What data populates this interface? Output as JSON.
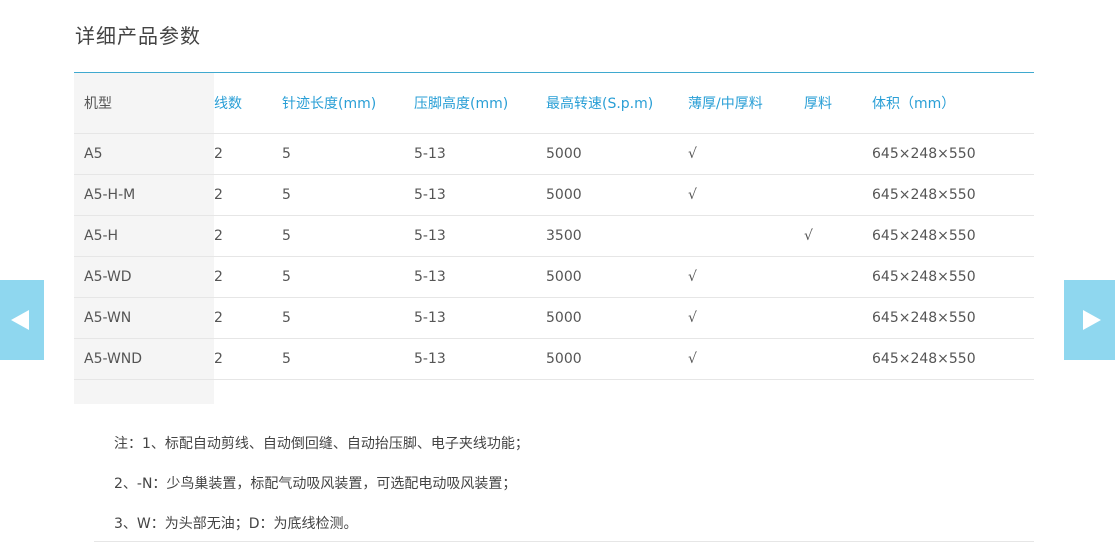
{
  "section": {
    "title": "详细产品参数"
  },
  "table": {
    "headers": [
      "机型",
      "线数",
      "针迹长度(mm)",
      "压脚高度(mm)",
      "最高转速(S.p.m)",
      "薄厚/中厚料",
      "厚料",
      "体积（mm）"
    ],
    "rows": [
      [
        "A5",
        "2",
        "5",
        "5-13",
        "5000",
        "√",
        "",
        "645×248×550"
      ],
      [
        "A5-H-M",
        "2",
        "5",
        "5-13",
        "5000",
        "√",
        "",
        "645×248×550"
      ],
      [
        "A5-H",
        "2",
        "5",
        "5-13",
        "3500",
        "",
        "√",
        "645×248×550"
      ],
      [
        "A5-WD",
        "2",
        "5",
        "5-13",
        "5000",
        "√",
        "",
        "645×248×550"
      ],
      [
        "A5-WN",
        "2",
        "5",
        "5-13",
        "5000",
        "√",
        "",
        "645×248×550"
      ],
      [
        "A5-WND",
        "2",
        "5",
        "5-13",
        "5000",
        "√",
        "",
        "645×248×550"
      ]
    ]
  },
  "notes": {
    "line1": "注：1、标配自动剪线、自动倒回缝、自动抬压脚、电子夹线功能；",
    "line2": "2、-N：少鸟巢装置，标配气动吸风装置，可选配电动吸风装置；",
    "line3": "3、W：为头部无油；D：为底线检测。"
  },
  "nav": {
    "prev_icon": "arrow-left-icon",
    "next_icon": "arrow-right-icon",
    "color": "#8fd7ef"
  },
  "colors": {
    "accent": "#2a9fd6",
    "rule": "#3fa9cf"
  }
}
